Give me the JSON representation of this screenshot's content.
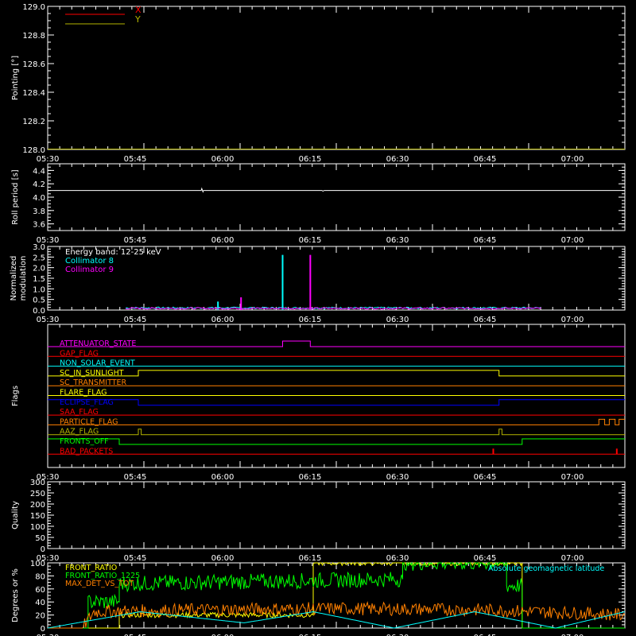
{
  "time_ticks": [
    "05:30",
    "05:45",
    "06:00",
    "06:15",
    "06:30",
    "06:45",
    "07:00"
  ],
  "chart_data": [
    {
      "type": "line",
      "ylabel": "Pointing [°]",
      "ylim": [
        128.0,
        129.0
      ],
      "yticks": [
        "128.0",
        "128.2",
        "128.4",
        "128.6",
        "128.8",
        "129.0"
      ],
      "legend_position": "top-left",
      "series": [
        {
          "name": "X",
          "color": "#ff0000",
          "values": [
            [
              0,
              128.0
            ],
            [
              100,
              128.0
            ]
          ]
        },
        {
          "name": "Y",
          "color": "#b5b500",
          "values": [
            [
              0,
              128.0
            ],
            [
              100,
              128.0
            ]
          ]
        }
      ]
    },
    {
      "type": "line",
      "ylabel": "Roll period [s]",
      "ylim": [
        3.5,
        4.5
      ],
      "yticks": [
        "3.6",
        "3.8",
        "4.0",
        "4.2",
        "4.4"
      ],
      "series": [
        {
          "color": "#ffffff",
          "values": [
            [
              0,
              4.1
            ],
            [
              26.6,
              4.1
            ],
            [
              26.7,
              4.13
            ],
            [
              26.9,
              4.08
            ],
            [
              27.0,
              4.1
            ],
            [
              47.5,
              4.1
            ],
            [
              47.7,
              4.09
            ],
            [
              47.9,
              4.1
            ],
            [
              100,
              4.1
            ]
          ]
        }
      ]
    },
    {
      "type": "line",
      "ylabel": "Normalized modulation",
      "ylim": [
        0.0,
        3.0
      ],
      "yticks": [
        "0.0",
        "0.5",
        "1.0",
        "1.5",
        "2.0",
        "2.5",
        "3.0"
      ],
      "annotation": "Energy band: 12-25 keV",
      "legend_position": "top-left",
      "series": [
        {
          "name": "Collimator 8",
          "color": "#00ffff",
          "values": [
            [
              13.5,
              0.1
            ],
            [
              85.5,
              0.1
            ]
          ],
          "spikes": [
            [
              29.5,
              0.4
            ],
            [
              40.7,
              2.6
            ]
          ]
        },
        {
          "name": "Collimator 9",
          "color": "#ff00ff",
          "values": [
            [
              13.5,
              0.08
            ],
            [
              85.5,
              0.08
            ]
          ],
          "spikes": [
            [
              33.5,
              0.6
            ],
            [
              45.5,
              2.6
            ]
          ]
        }
      ]
    },
    {
      "type": "step",
      "ylabel": "Flags",
      "flags": [
        {
          "name": "ATTENUATOR_STATE",
          "color": "#ff00ff",
          "segments": [
            [
              0,
              0
            ],
            [
              40.7,
              0
            ],
            [
              40.7,
              1
            ],
            [
              45.5,
              1
            ],
            [
              45.5,
              0
            ],
            [
              100,
              0
            ]
          ]
        },
        {
          "name": "GAP_FLAG",
          "color": "#ff0000",
          "segments": [
            [
              0,
              0
            ],
            [
              100,
              0
            ]
          ]
        },
        {
          "name": "NON_SOLAR_EVENT",
          "color": "#00ffff",
          "segments": [
            [
              0,
              0
            ],
            [
              100,
              0
            ]
          ]
        },
        {
          "name": "SC_IN_SUNLIGHT",
          "color": "#ffff00",
          "segments": [
            [
              0,
              0
            ],
            [
              15.7,
              0
            ],
            [
              15.7,
              1
            ],
            [
              78.2,
              1
            ],
            [
              78.2,
              0
            ],
            [
              100,
              0
            ]
          ]
        },
        {
          "name": "SC_TRANSMITTER",
          "color": "#ff8000",
          "segments": [
            [
              0,
              0
            ],
            [
              100,
              0
            ]
          ]
        },
        {
          "name": "FLARE_FLAG",
          "color": "#ffff00",
          "segments": [
            [
              0,
              0
            ],
            [
              100,
              0
            ]
          ]
        },
        {
          "name": "ECLIPSE_FLAG",
          "color": "#0000ff",
          "segments": [
            [
              0,
              1
            ],
            [
              15.7,
              1
            ],
            [
              15.7,
              0
            ],
            [
              78.2,
              0
            ],
            [
              78.2,
              1
            ],
            [
              100,
              1
            ]
          ]
        },
        {
          "name": "SAA_FLAG",
          "color": "#ff0000",
          "segments": [
            [
              0,
              0
            ],
            [
              100,
              0
            ]
          ]
        },
        {
          "name": "PARTICLE_FLAG",
          "color": "#ff8000",
          "segments": [
            [
              0,
              0
            ],
            [
              95.5,
              0
            ],
            [
              95.5,
              1
            ],
            [
              96.5,
              1
            ],
            [
              96.5,
              0
            ],
            [
              97.3,
              0
            ],
            [
              97.3,
              1
            ],
            [
              98.3,
              1
            ],
            [
              98.3,
              0
            ],
            [
              99.0,
              0
            ],
            [
              99.0,
              1
            ],
            [
              100,
              1
            ]
          ]
        },
        {
          "name": "AAZ_FLAG",
          "color": "#b5b500",
          "segments": [
            [
              0,
              0
            ],
            [
              15.7,
              0
            ],
            [
              15.7,
              1
            ],
            [
              16.2,
              1
            ],
            [
              16.2,
              0
            ],
            [
              78.2,
              0
            ],
            [
              78.2,
              1
            ],
            [
              78.7,
              1
            ],
            [
              78.7,
              0
            ],
            [
              100,
              0
            ]
          ]
        },
        {
          "name": "FRONTS_OFF",
          "color": "#00ff00",
          "segments": [
            [
              0,
              1
            ],
            [
              12.4,
              1
            ],
            [
              12.4,
              0
            ],
            [
              82.2,
              0
            ],
            [
              82.2,
              1
            ],
            [
              100,
              1
            ]
          ]
        },
        {
          "name": "BAD_PACKETS",
          "color": "#ff0000",
          "segments": [
            [
              0,
              0
            ],
            [
              100,
              0
            ]
          ],
          "spikes": [
            77.2,
            98.6
          ]
        }
      ]
    },
    {
      "type": "line",
      "ylabel": "Quality",
      "ylim": [
        0,
        300
      ],
      "yticks": [
        "0",
        "50",
        "100",
        "150",
        "200",
        "250",
        "300"
      ],
      "series": []
    },
    {
      "type": "line",
      "ylabel": "Degrees or %",
      "ylim": [
        0,
        100
      ],
      "yticks": [
        "0",
        "20",
        "40",
        "60",
        "80",
        "100"
      ],
      "legend_position": "top-left",
      "series": [
        {
          "name": "FRONT_RATIO",
          "color": "#ffff00",
          "values": [
            [
              0,
              0
            ],
            [
              12.4,
              0
            ],
            [
              12.4,
              20
            ],
            [
              46,
              20
            ],
            [
              46,
              100
            ],
            [
              82.2,
              100
            ],
            [
              82.2,
              0
            ],
            [
              100,
              0
            ]
          ]
        },
        {
          "name": "FRONT_RATIO_1225",
          "color": "#00ff00",
          "values": [
            [
              0,
              0
            ],
            [
              7,
              0
            ],
            [
              7,
              40
            ],
            [
              12.4,
              40
            ],
            [
              12.4,
              68
            ],
            [
              60,
              75
            ],
            [
              61.5,
              75
            ],
            [
              61.5,
              100
            ],
            [
              72,
              100
            ],
            [
              79.5,
              100
            ],
            [
              79.5,
              65
            ],
            [
              82.2,
              65
            ],
            [
              82.2,
              0
            ],
            [
              100,
              0
            ]
          ]
        },
        {
          "name": "MAX_DET_VS_TOT",
          "color": "#ff8000",
          "values": [
            [
              0,
              0
            ],
            [
              6,
              0
            ],
            [
              8,
              25
            ],
            [
              25,
              28
            ],
            [
              50,
              30
            ],
            [
              75,
              28
            ],
            [
              95,
              22
            ],
            [
              100,
              20
            ]
          ]
        },
        {
          "name": "Absolute geomagnetic latitude",
          "color": "#00ffff",
          "values": [
            [
              0,
              0
            ],
            [
              16,
              25
            ],
            [
              34,
              8
            ],
            [
              46,
              25
            ],
            [
              60,
              0
            ],
            [
              74,
              25
            ],
            [
              88,
              0
            ],
            [
              100,
              25
            ]
          ]
        }
      ]
    }
  ]
}
